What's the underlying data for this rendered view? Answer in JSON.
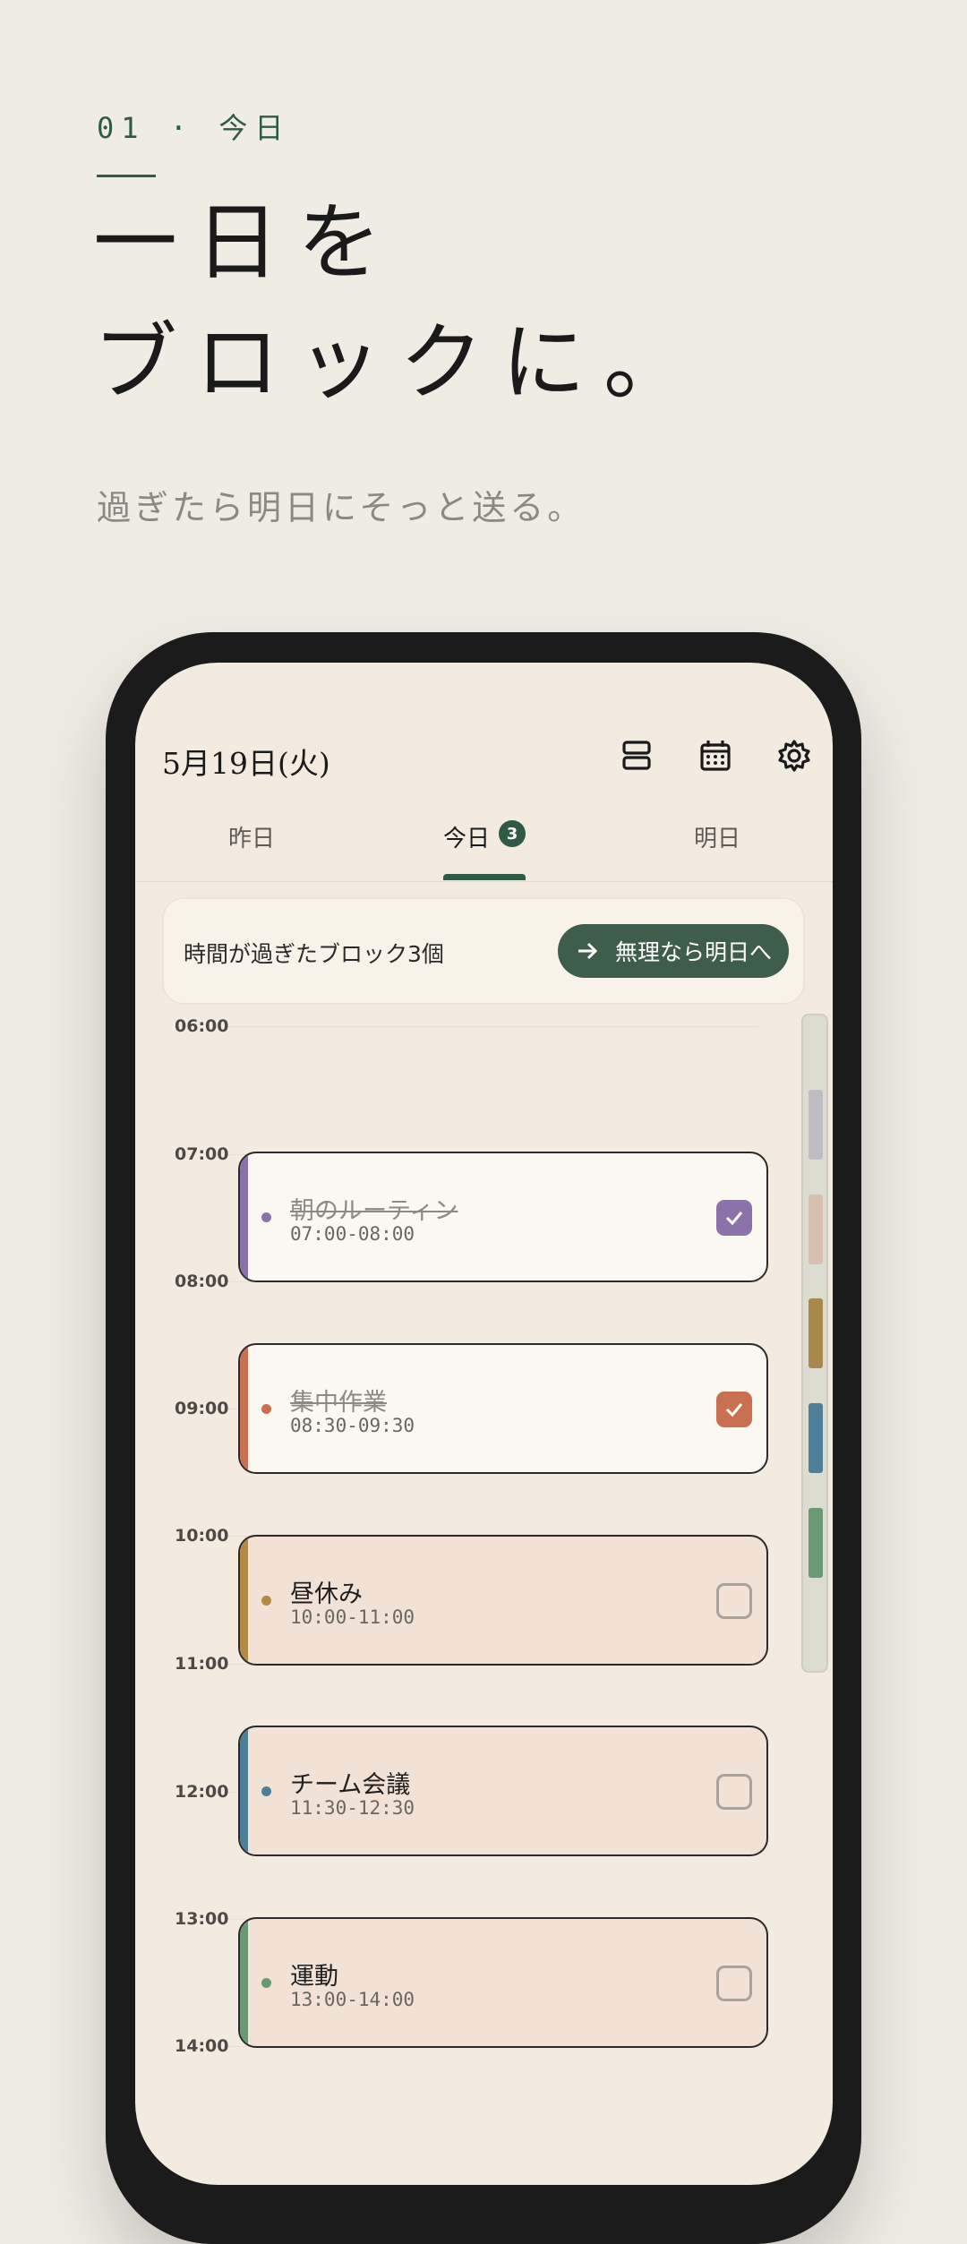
{
  "hero": {
    "eyebrow": "01 · 今日",
    "headline_line1": "一日を",
    "headline_line2": "ブロックに。",
    "subline": "過ぎたら明日にそっと送る。"
  },
  "app": {
    "date": "5月19日(火)",
    "icons": [
      "stack-view-icon",
      "calendar-icon",
      "settings-gear-icon"
    ],
    "tabs": [
      {
        "label": "昨日"
      },
      {
        "label": "今日",
        "badge": "3",
        "active": true
      },
      {
        "label": "明日"
      }
    ],
    "overdue": {
      "text": "時間が過ぎたブロック3個",
      "button_label": "無理なら明日へ"
    },
    "time_labels": [
      "06:00",
      "07:00",
      "08:00",
      "09:00",
      "10:00",
      "11:00",
      "12:00",
      "13:00",
      "14:00"
    ],
    "blocks": [
      {
        "title": "朝のルーティン",
        "time": "07:00-08:00",
        "done": true,
        "color": "#8b72a8"
      },
      {
        "title": "集中作業",
        "time": "08:30-09:30",
        "done": true,
        "color": "#c8704f"
      },
      {
        "title": "昼休み",
        "time": "10:00-11:00",
        "done": false,
        "color": "#b38a45"
      },
      {
        "title": "チーム会議",
        "time": "11:30-12:30",
        "done": false,
        "color": "#4d7f98"
      },
      {
        "title": "運動",
        "time": "13:00-14:00",
        "done": false,
        "color": "#6a9a74"
      }
    ],
    "scrollbar_colors": [
      "#c0bcc4",
      "#d8c0b0",
      "#a8884c",
      "#4d7f98",
      "#6a9a74"
    ],
    "colors": {
      "accent": "#2f5b45",
      "background": "#efece4",
      "screen": "#f3ebe0"
    }
  }
}
